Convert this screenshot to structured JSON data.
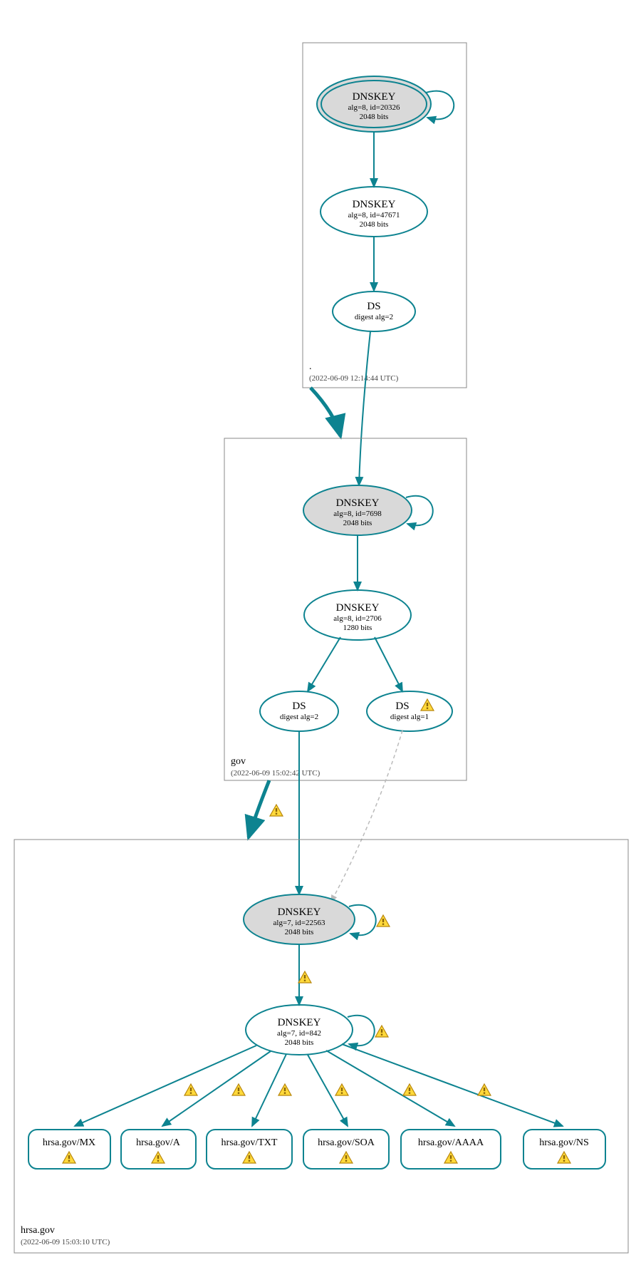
{
  "colors": {
    "accent": "#0d8390",
    "node_fill_gray": "#d9d9d9",
    "warn_fill": "#ffd93b",
    "warn_stroke": "#b8860b"
  },
  "zones": [
    {
      "name": ".",
      "timestamp": "(2022-06-09 12:14:44 UTC)"
    },
    {
      "name": "gov",
      "timestamp": "(2022-06-09 15:02:42 UTC)"
    },
    {
      "name": "hrsa.gov",
      "timestamp": "(2022-06-09 15:03:10 UTC)"
    }
  ],
  "nodes": {
    "root_ksk": {
      "title": "DNSKEY",
      "line2": "alg=8, id=20326",
      "line3": "2048 bits",
      "fill": "gray",
      "double": true,
      "self": true
    },
    "root_zsk": {
      "title": "DNSKEY",
      "line2": "alg=8, id=47671",
      "line3": "2048 bits"
    },
    "root_ds": {
      "title": "DS",
      "line2": "digest alg=2"
    },
    "gov_ksk": {
      "title": "DNSKEY",
      "line2": "alg=8, id=7698",
      "line3": "2048 bits",
      "fill": "gray",
      "self": true
    },
    "gov_zsk": {
      "title": "DNSKEY",
      "line2": "alg=8, id=2706",
      "line3": "1280 bits"
    },
    "gov_ds1": {
      "title": "DS",
      "line2": "digest alg=2"
    },
    "gov_ds2": {
      "title": "DS",
      "line2": "digest alg=1",
      "warn": true
    },
    "hrsa_ksk": {
      "title": "DNSKEY",
      "line2": "alg=7, id=22563",
      "line3": "2048 bits",
      "fill": "gray",
      "self": true,
      "self_warn": true
    },
    "hrsa_zsk": {
      "title": "DNSKEY",
      "line2": "alg=7, id=842",
      "line3": "2048 bits",
      "self": true,
      "self_warn": true
    }
  },
  "records": [
    {
      "label": "hrsa.gov/MX",
      "warn": true
    },
    {
      "label": "hrsa.gov/A",
      "warn": true
    },
    {
      "label": "hrsa.gov/TXT",
      "warn": true
    },
    {
      "label": "hrsa.gov/SOA",
      "warn": true
    },
    {
      "label": "hrsa.gov/AAAA",
      "warn": true
    },
    {
      "label": "hrsa.gov/NS",
      "warn": true
    }
  ],
  "edge_warnings": {
    "gov_to_hrsa": true,
    "hrsa_ksk_to_zsk": true,
    "zsk_to_records": [
      true,
      true,
      true,
      true,
      true,
      true
    ]
  }
}
